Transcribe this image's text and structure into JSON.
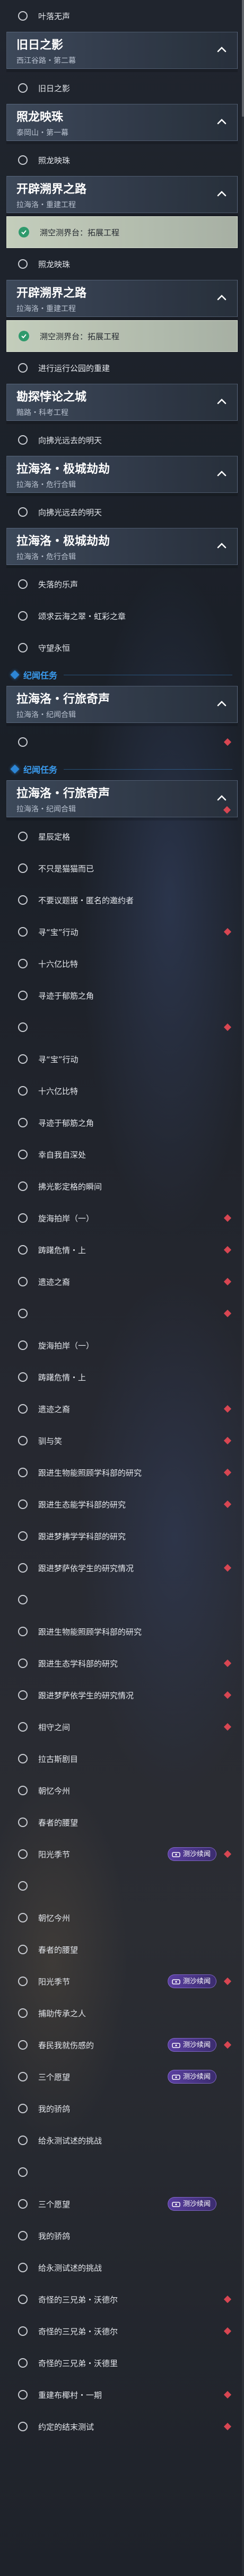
{
  "colors": {
    "accent_blue": "#3a9cf0",
    "red_marker": "#d84652",
    "badge_purple": "#5a3fa0",
    "check_green": "#2f9a6c"
  },
  "icons": {
    "chevron": "chevron-up-icon",
    "quest": "circle-icon",
    "active": "check-circle-icon",
    "tracked": "red-diamond-icon",
    "badge": "ticket-icon"
  },
  "items": [
    {
      "type": "row",
      "text": "叶落无声"
    },
    {
      "type": "chapter",
      "title": "旧日之影",
      "subtitle": "西江谷路・第二幕"
    },
    {
      "type": "row",
      "text": "旧日之影"
    },
    {
      "type": "chapter",
      "title": "照龙映珠",
      "subtitle": "泰岡山・第一幕"
    },
    {
      "type": "row",
      "text": "照龙映珠"
    },
    {
      "type": "chapter",
      "title": "开辟溯界之路",
      "subtitle": "拉海洛・重建工程"
    },
    {
      "type": "row",
      "text": "溯空测界台：拓展工程",
      "active": true
    },
    {
      "type": "row",
      "text": "照龙映珠"
    },
    {
      "type": "chapter",
      "title": "开辟溯界之路",
      "subtitle": "拉海洛・重建工程"
    },
    {
      "type": "row",
      "text": "溯空测界台：拓展工程",
      "active": true
    },
    {
      "type": "row",
      "text": "进行运行公园的重建"
    },
    {
      "type": "chapter",
      "title": "勘探悖论之城",
      "subtitle": "黯路・科考工程"
    },
    {
      "type": "row",
      "text": "向拂光远去的明天"
    },
    {
      "type": "chapter",
      "title": "拉海洛・极城劫劫",
      "subtitle": "拉海洛・危行合辑"
    },
    {
      "type": "row",
      "text": "向拂光远去的明天"
    },
    {
      "type": "chapter",
      "title": "拉海洛・极城劫劫",
      "subtitle": "拉海洛・危行合辑"
    },
    {
      "type": "row",
      "text": "失落的乐声"
    },
    {
      "type": "row",
      "text": "颂求云海之翠・虹彩之章"
    },
    {
      "type": "row",
      "text": "守望永恒"
    },
    {
      "type": "section",
      "label": "纪闻任务"
    },
    {
      "type": "chapter",
      "title": "拉海洛・行旅奇声",
      "subtitle": "拉海洛・纪闻合辑"
    },
    {
      "type": "row",
      "text": "",
      "red": true
    },
    {
      "type": "section",
      "label": "纪闻任务"
    },
    {
      "type": "chapter",
      "title": "拉海洛・行旅奇声",
      "subtitle": "拉海洛・纪闻合辑",
      "red": true
    },
    {
      "type": "row",
      "text": "星辰定格"
    },
    {
      "type": "row",
      "text": "不只是猫猫而已"
    },
    {
      "type": "row",
      "text": "不要议题据・匿名的邀约者"
    },
    {
      "type": "row",
      "text": "寻“宝”行动",
      "red": true
    },
    {
      "type": "row",
      "text": "十六亿比特"
    },
    {
      "type": "row",
      "text": "寻迹于郁筋之角"
    },
    {
      "type": "row",
      "text": "",
      "red": true
    },
    {
      "type": "row",
      "text": "寻“宝”行动"
    },
    {
      "type": "row",
      "text": "十六亿比特"
    },
    {
      "type": "row",
      "text": "寻迹于郁筋之角"
    },
    {
      "type": "row",
      "text": "幸自我自深处"
    },
    {
      "type": "row",
      "text": "拂光影定格的瞬间"
    },
    {
      "type": "row",
      "text": "旋海拍岸（一）",
      "red": true
    },
    {
      "type": "row",
      "text": "踌躇危情・上",
      "red": true
    },
    {
      "type": "row",
      "text": "遗迹之裔",
      "red": true
    },
    {
      "type": "row",
      "text": "",
      "red": true
    },
    {
      "type": "row",
      "text": "旋海拍岸（一）"
    },
    {
      "type": "row",
      "text": "踌躇危情・上"
    },
    {
      "type": "row",
      "text": "遗迹之裔",
      "red": true
    },
    {
      "type": "row",
      "text": "驯与笑",
      "red": true
    },
    {
      "type": "row",
      "text": "跟进生物能照顾学科部的研究",
      "red": true
    },
    {
      "type": "row",
      "text": "跟进生态能学科部的研究",
      "red": true
    },
    {
      "type": "row",
      "text": "跟进梦拂学学科部的研究"
    },
    {
      "type": "row",
      "text": "跟进梦萨依学生的研究情况",
      "red": true
    },
    {
      "type": "row",
      "text": ""
    },
    {
      "type": "row",
      "text": "跟进生物能照顾学科部的研究"
    },
    {
      "type": "row",
      "text": "跟进生态学科部的研究",
      "red": true
    },
    {
      "type": "row",
      "text": "跟进梦萨依学生的研究情况",
      "red": true
    },
    {
      "type": "row",
      "text": "相守之间",
      "red": true
    },
    {
      "type": "row",
      "text": "拉古斯剧目"
    },
    {
      "type": "row",
      "text": "朝忆今州"
    },
    {
      "type": "row",
      "text": "春者的腰望"
    },
    {
      "type": "row",
      "text": "阳光季节",
      "badge": "测沙续闻",
      "red": true
    },
    {
      "type": "row",
      "text": ""
    },
    {
      "type": "row",
      "text": "朝忆今州"
    },
    {
      "type": "row",
      "text": "春者的腰望"
    },
    {
      "type": "row",
      "text": "阳光季节",
      "badge": "测沙续闻",
      "red": true
    },
    {
      "type": "row",
      "text": "捕助传承之人"
    },
    {
      "type": "row",
      "text": "春民我就伤感的",
      "badge": "测沙续闻",
      "red": true
    },
    {
      "type": "row",
      "text": "三个愿望",
      "badge": "测沙续闻"
    },
    {
      "type": "row",
      "text": "我的骄鸽"
    },
    {
      "type": "row",
      "text": "给永测试述的挑战"
    },
    {
      "type": "row",
      "text": ""
    },
    {
      "type": "row",
      "text": "三个愿望",
      "badge": "测沙续闻"
    },
    {
      "type": "row",
      "text": "我的骄鸽"
    },
    {
      "type": "row",
      "text": "给永测试述的挑战"
    },
    {
      "type": "row",
      "text": "奇怪的三兄弟・沃德尔",
      "red": true
    },
    {
      "type": "row",
      "text": "奇怪的三兄弟・沃德尔",
      "red": true
    },
    {
      "type": "row",
      "text": "奇怪的三兄弟・沃德里"
    },
    {
      "type": "row",
      "text": "重建布椰村・一期",
      "red": true
    },
    {
      "type": "row",
      "text": "约定的结末测试",
      "red": true
    }
  ]
}
